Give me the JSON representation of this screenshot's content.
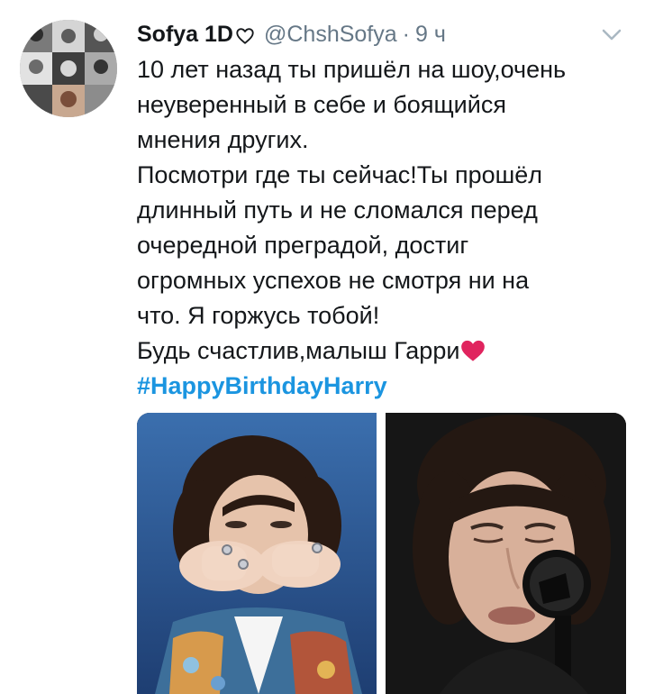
{
  "tweet": {
    "display_name": "Sofya 1D",
    "name_heart_icon": "outline-heart-icon",
    "handle": "@ChshSofya",
    "separator": "·",
    "time": "9 ч",
    "menu_icon": "chevron-down-icon",
    "lines": [
      "10 лет назад ты пришёл на шоу,очень",
      "неуверенный в себе и боящийся",
      "мнения других.",
      "Посмотри где ты сейчас!Ты прошёл",
      "длинный путь и не сломался перед",
      "очередной преградой, достиг",
      "огромных успехов не смотря ни на",
      "что. Я горжусь тобой!",
      "Будь счастлив,малыш Гарри"
    ],
    "emoji_icon": "red-heart-icon",
    "hashtag": "#HappyBirthdayHarry",
    "colors": {
      "hashtag": "#1b95e0",
      "secondary_text": "#657786",
      "heart": "#e0245e"
    }
  },
  "media": {
    "photos": [
      {
        "name": "photo-blowing-kiss"
      },
      {
        "name": "photo-singing-at-microphone"
      }
    ]
  }
}
